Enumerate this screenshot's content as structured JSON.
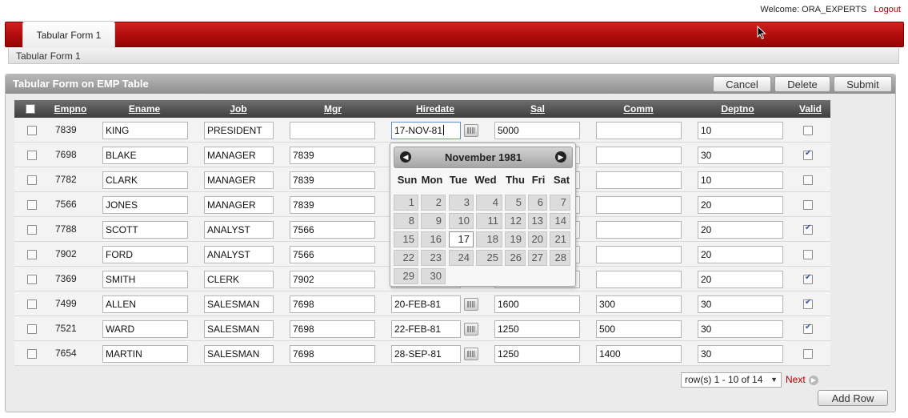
{
  "header": {
    "welcome_label": "Welcome: ORA_EXPERTS",
    "logout_label": "Logout",
    "tab_label": "Tabular Form 1",
    "breadcrumb": "Tabular Form 1"
  },
  "region": {
    "title": "Tabular Form on EMP Table",
    "buttons": {
      "cancel": "Cancel",
      "delete": "Delete",
      "submit": "Submit"
    }
  },
  "columns": [
    "Empno",
    "Ename",
    "Job",
    "Mgr",
    "Hiredate",
    "Sal",
    "Comm",
    "Deptno",
    "Valid"
  ],
  "rows": [
    {
      "empno": "7839",
      "ename": "KING",
      "job": "PRESIDENT",
      "mgr": "",
      "hiredate": "17-NOV-81",
      "sal": "5000",
      "comm": "",
      "deptno": "10",
      "valid": false
    },
    {
      "empno": "7698",
      "ename": "BLAKE",
      "job": "MANAGER",
      "mgr": "7839",
      "hiredate": "",
      "sal": "",
      "comm": "",
      "deptno": "30",
      "valid": true
    },
    {
      "empno": "7782",
      "ename": "CLARK",
      "job": "MANAGER",
      "mgr": "7839",
      "hiredate": "",
      "sal": "",
      "comm": "",
      "deptno": "10",
      "valid": false
    },
    {
      "empno": "7566",
      "ename": "JONES",
      "job": "MANAGER",
      "mgr": "7839",
      "hiredate": "",
      "sal": "",
      "comm": "",
      "deptno": "20",
      "valid": false
    },
    {
      "empno": "7788",
      "ename": "SCOTT",
      "job": "ANALYST",
      "mgr": "7566",
      "hiredate": "",
      "sal": "",
      "comm": "",
      "deptno": "20",
      "valid": true
    },
    {
      "empno": "7902",
      "ename": "FORD",
      "job": "ANALYST",
      "mgr": "7566",
      "hiredate": "",
      "sal": "",
      "comm": "",
      "deptno": "20",
      "valid": false
    },
    {
      "empno": "7369",
      "ename": "SMITH",
      "job": "CLERK",
      "mgr": "7902",
      "hiredate": "",
      "sal": "",
      "comm": "",
      "deptno": "20",
      "valid": true
    },
    {
      "empno": "7499",
      "ename": "ALLEN",
      "job": "SALESMAN",
      "mgr": "7698",
      "hiredate": "20-FEB-81",
      "sal": "1600",
      "comm": "300",
      "deptno": "30",
      "valid": true
    },
    {
      "empno": "7521",
      "ename": "WARD",
      "job": "SALESMAN",
      "mgr": "7698",
      "hiredate": "22-FEB-81",
      "sal": "1250",
      "comm": "500",
      "deptno": "30",
      "valid": true
    },
    {
      "empno": "7654",
      "ename": "MARTIN",
      "job": "SALESMAN",
      "mgr": "7698",
      "hiredate": "28-SEP-81",
      "sal": "1250",
      "comm": "1400",
      "deptno": "30",
      "valid": false
    }
  ],
  "pagination": {
    "range_label": "row(s) 1 - 10 of 14",
    "next_label": "Next"
  },
  "add_row_label": "Add Row",
  "calendar": {
    "title": "November 1981",
    "weekdays": [
      "Sun",
      "Mon",
      "Tue",
      "Wed",
      "Thu",
      "Fri",
      "Sat"
    ],
    "days": [
      [
        "1",
        "2",
        "3",
        "4",
        "5",
        "6",
        "7"
      ],
      [
        "8",
        "9",
        "10",
        "11",
        "12",
        "13",
        "14"
      ],
      [
        "15",
        "16",
        "17",
        "18",
        "19",
        "20",
        "21"
      ],
      [
        "22",
        "23",
        "24",
        "25",
        "26",
        "27",
        "28"
      ],
      [
        "29",
        "30",
        "",
        "",
        "",
        "",
        ""
      ]
    ],
    "selected_day": "17"
  },
  "colors": {
    "brand_red": "#b00d0d",
    "link_red": "#b00000",
    "header_gray": "#8f8f8f"
  }
}
